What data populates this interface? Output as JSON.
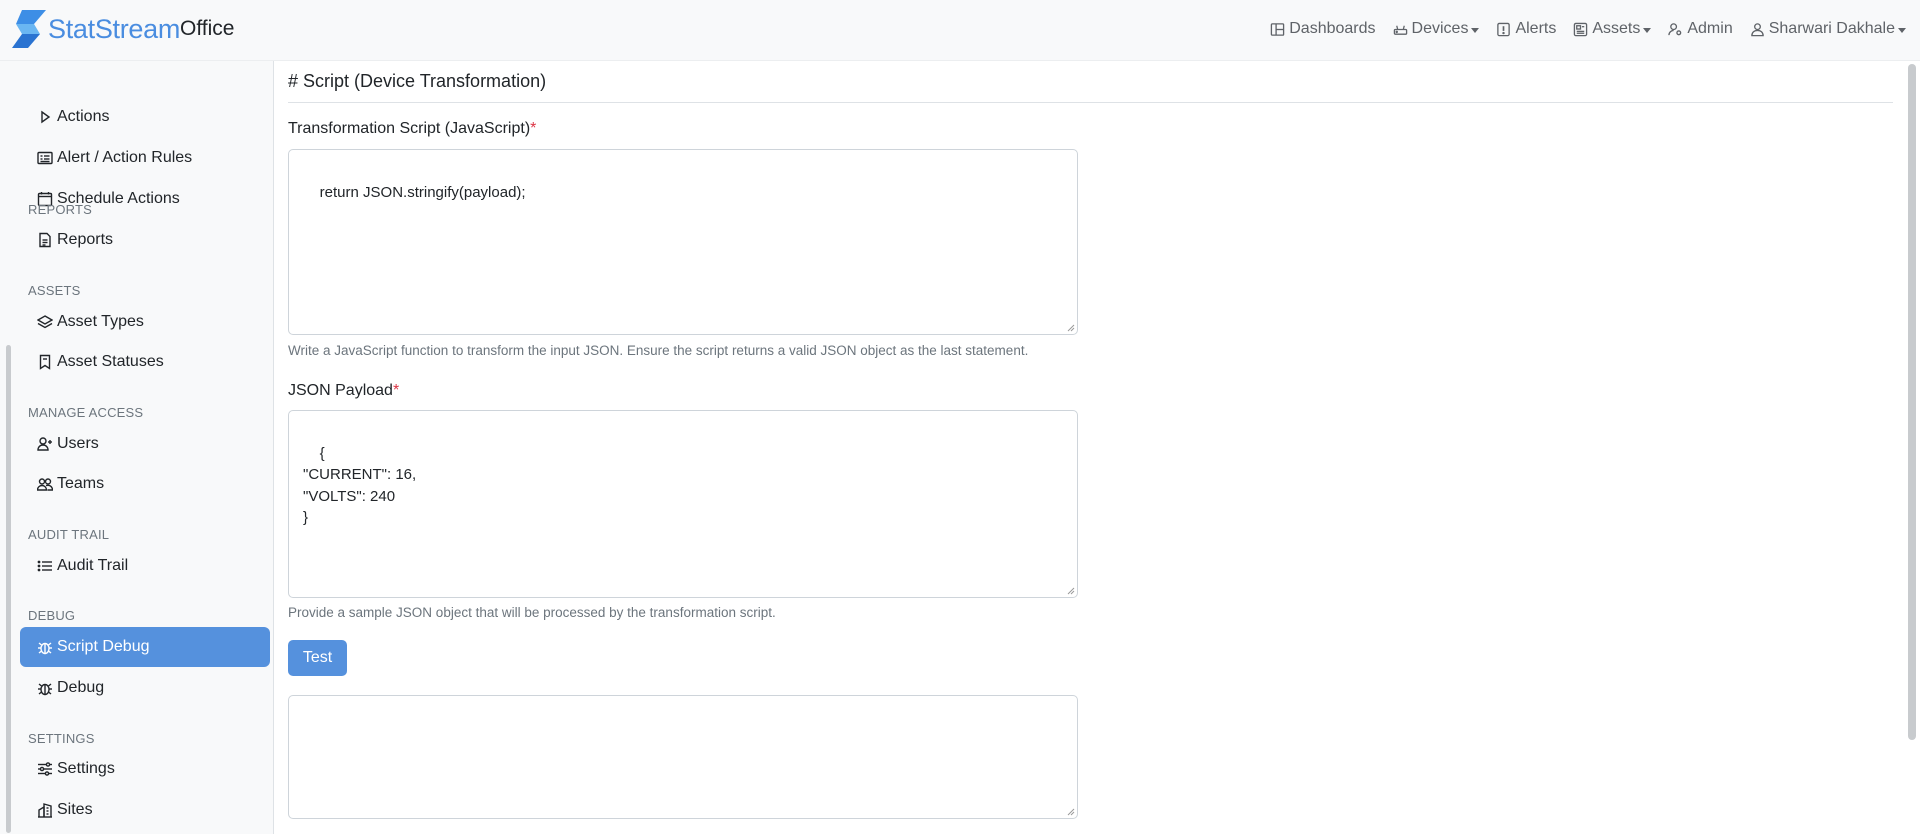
{
  "brand": {
    "name": "StatStream",
    "org": "Office",
    "accent": "#4a8de0"
  },
  "nav": [
    {
      "id": "dashboards",
      "label": "Dashboards",
      "icon": "dashboard-icon",
      "dropdown": false
    },
    {
      "id": "devices",
      "label": "Devices",
      "icon": "router-icon",
      "dropdown": true
    },
    {
      "id": "alerts",
      "label": "Alerts",
      "icon": "alert-icon",
      "dropdown": false
    },
    {
      "id": "assets",
      "label": "Assets",
      "icon": "assets-icon",
      "dropdown": true
    },
    {
      "id": "admin",
      "label": "Admin",
      "icon": "admin-icon",
      "dropdown": false
    },
    {
      "id": "user",
      "label": "Sharwari Dakhale",
      "icon": "user-icon",
      "dropdown": true
    }
  ],
  "sidebar": {
    "items": [
      {
        "label": "Actions",
        "icon": "play-icon"
      },
      {
        "label": "Alert / Action Rules",
        "icon": "rules-icon"
      },
      {
        "label": "Schedule Actions",
        "icon": "calendar-icon"
      },
      {
        "label": "Reports",
        "icon": "report-icon"
      },
      {
        "label": "Asset Types",
        "icon": "layers-icon"
      },
      {
        "label": "Asset Statuses",
        "icon": "bookmark-icon"
      },
      {
        "label": "Users",
        "icon": "user-plus-icon"
      },
      {
        "label": "Teams",
        "icon": "people-icon"
      },
      {
        "label": "Audit Trail",
        "icon": "list-icon"
      },
      {
        "label": "Script Debug",
        "icon": "bug-icon",
        "active": true
      },
      {
        "label": "Debug",
        "icon": "bug-icon"
      },
      {
        "label": "Settings",
        "icon": "sliders-icon"
      },
      {
        "label": "Sites",
        "icon": "building-icon"
      }
    ],
    "sections": {
      "reports": "REPORTS",
      "assets": "ASSETS",
      "manage_access": "MANAGE ACCESS",
      "audit_trail": "AUDIT TRAIL",
      "debug": "DEBUG",
      "settings": "SETTINGS"
    }
  },
  "main": {
    "title": "# Script (Device Transformation)",
    "script": {
      "label": "Transformation Script (JavaScript)",
      "required": "*",
      "value": "return JSON.stringify(payload);",
      "help": "Write a JavaScript function to transform the input JSON. Ensure the script returns a valid JSON object as the last statement."
    },
    "payload": {
      "label": "JSON Payload",
      "required": "*",
      "value": "{\n\"CURRENT\": 16,\n\"VOLTS\": 240\n}",
      "help": "Provide a sample JSON object that will be processed by the transformation script."
    },
    "test_button": "Test",
    "output": {
      "value": ""
    }
  }
}
